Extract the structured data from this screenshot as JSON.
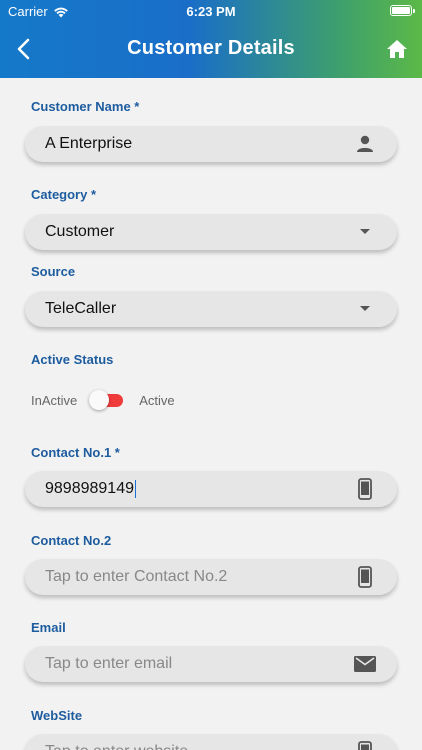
{
  "status_bar": {
    "carrier": "Carrier",
    "time": "6:23 PM"
  },
  "header": {
    "title": "Customer Details"
  },
  "form": {
    "customer_name": {
      "label": "Customer Name *",
      "value": "A Enterprise",
      "icon": "person-icon"
    },
    "category": {
      "label": "Category *",
      "value": "Customer",
      "icon": "dropdown-arrow-icon"
    },
    "source": {
      "label": "Source",
      "value": "TeleCaller",
      "icon": "dropdown-arrow-icon"
    },
    "active_status": {
      "label": "Active Status",
      "off_label": "InActive",
      "on_label": "Active",
      "state": "InActive"
    },
    "contact1": {
      "label": "Contact No.1 *",
      "value": "9898989149",
      "icon": "phone-icon"
    },
    "contact2": {
      "label": "Contact No.2",
      "placeholder": "Tap to enter Contact No.2",
      "icon": "phone-icon"
    },
    "email": {
      "label": "Email",
      "placeholder": "Tap to enter email",
      "icon": "mail-icon"
    },
    "website": {
      "label": "WebSite",
      "placeholder": "Tap to enter website",
      "icon": "phone-icon"
    }
  },
  "colors": {
    "header_gradient_start": "#1579c9",
    "header_gradient_end": "#5cb947",
    "label": "#1d5c9e",
    "switch_track": "#f03b3b"
  }
}
